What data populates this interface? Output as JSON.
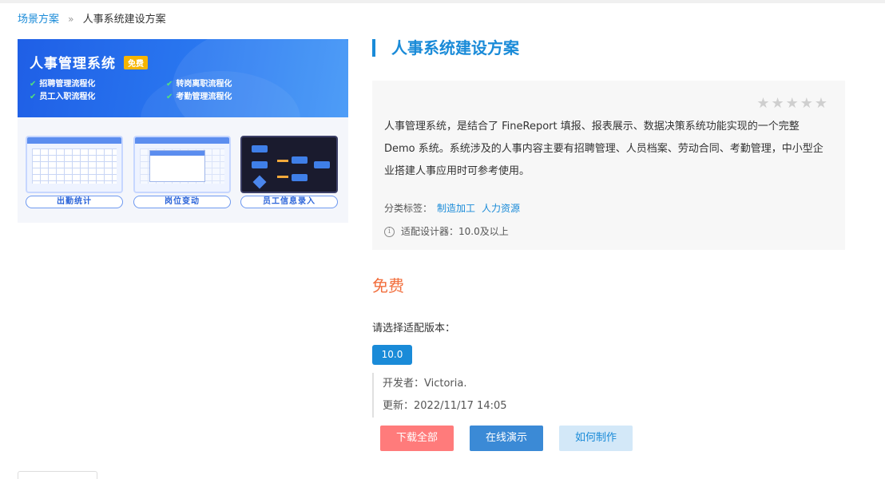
{
  "breadcrumb": {
    "root": "场景方案",
    "separator": "»",
    "current": "人事系统建设方案"
  },
  "preview": {
    "banner_title": "人事管理系统",
    "badge": "免费",
    "features": [
      "招聘管理流程化",
      "转岗离职流程化",
      "员工入职流程化",
      "考勤管理流程化"
    ],
    "cards": [
      {
        "label": "出勤统计"
      },
      {
        "label": "岗位变动"
      },
      {
        "label": "员工信息录入"
      }
    ]
  },
  "product": {
    "title": "人事系统建设方案",
    "rating_stars": "★★★★★",
    "rating_value": 0,
    "description": "人事管理系统，是结合了 FineReport 填报、报表展示、数据决策系统功能实现的一个完整 Demo 系统。系统涉及的人事内容主要有招聘管理、人员档案、劳动合同、考勤管理，中小型企业搭建人事应用时可参考使用。",
    "tags_label": "分类标签：",
    "tags": [
      "制造加工",
      "人力资源"
    ],
    "designer_info_icon": "i",
    "designer": "适配设计器：10.0及以上",
    "price": "免费",
    "version_prompt": "请选择适配版本：",
    "version": "10.0",
    "developer": "开发者：Victoria.",
    "updated": "更新：2022/11/17 14:05"
  },
  "actions": {
    "download": "下载全部",
    "demo": "在线演示",
    "howto": "如何制作"
  },
  "colors": {
    "accent": "#1a8bd8",
    "price": "#f26f3e",
    "download_button": "#ff7b7b",
    "demo_button": "#3b8ad6",
    "howto_button": "#d3e8f8"
  }
}
